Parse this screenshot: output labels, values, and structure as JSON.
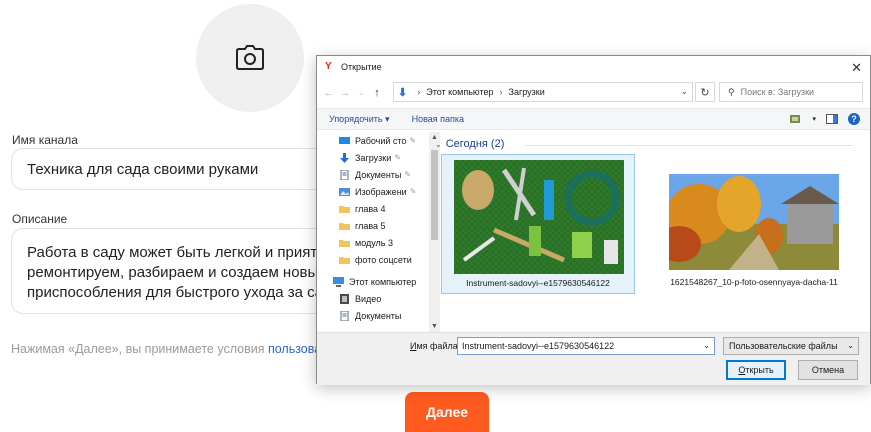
{
  "page": {
    "channel_name_label": "Имя канала",
    "channel_name_value": "Техника для сада своими руками",
    "description_label": "Описание",
    "description_lines": [
      "Работа в саду может быть легкой и приятно",
      "ремонтируем, разбираем и создаем новые",
      "приспособления для быстрого ухода за сад"
    ],
    "terms_text": "Нажимая «Далее», вы принимаете условия ",
    "terms_link": "пользова",
    "next_button": "Далее",
    "accent_color": "#ff5a1f"
  },
  "dialog": {
    "title": "Открытие",
    "breadcrumb": [
      "Этот компьютер",
      "Загрузки"
    ],
    "search_placeholder": "Поиск в: Загрузки",
    "commands": {
      "organize": "Упорядочить ▾",
      "new_folder": "Новая папка"
    },
    "sidebar": [
      {
        "label": "Рабочий сто",
        "icon": "desktop-icon",
        "pinned": true
      },
      {
        "label": "Загрузки",
        "icon": "download-icon",
        "pinned": true
      },
      {
        "label": "Документы",
        "icon": "document-icon",
        "pinned": true
      },
      {
        "label": "Изображени",
        "icon": "pictures-icon",
        "pinned": true
      },
      {
        "label": "глава 4",
        "icon": "folder-icon",
        "pinned": false
      },
      {
        "label": "глава 5",
        "icon": "folder-icon",
        "pinned": false
      },
      {
        "label": "модуль 3",
        "icon": "folder-icon",
        "pinned": false
      },
      {
        "label": "фото соцсети",
        "icon": "folder-icon",
        "pinned": false
      },
      {
        "label": "Этот компьютер",
        "icon": "computer-icon",
        "pinned": false
      },
      {
        "label": "Видео",
        "icon": "video-icon",
        "pinned": false
      },
      {
        "label": "Документы",
        "icon": "document-icon",
        "pinned": false
      }
    ],
    "group_header": "Сегодня (2)",
    "files": [
      {
        "name": "Instrument-sadovyi--e1579630546122",
        "selected": true
      },
      {
        "name": "1621548267_10-p-foto-osennyaya-dacha-11",
        "selected": false
      }
    ],
    "filename_label_prefix": "И",
    "filename_label_rest": "мя файла:",
    "filename_value": "Instrument-sadovyi--e1579630546122",
    "filetype": "Пользовательские файлы",
    "open_button_prefix": "О",
    "open_button_rest": "ткрыть",
    "cancel_button": "Отмена"
  }
}
